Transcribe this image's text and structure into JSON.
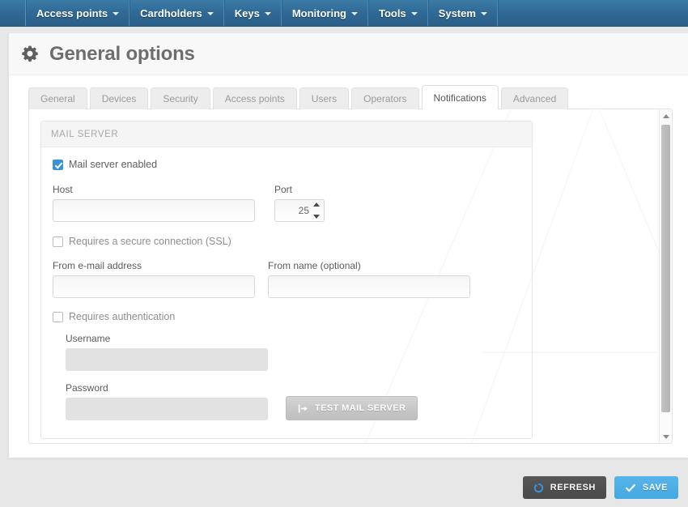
{
  "navbar": {
    "items": [
      {
        "label": "Access points",
        "icon": "chevron-down-icon",
        "has_caret": true
      },
      {
        "label": "Cardholders",
        "icon": "chevron-down-icon",
        "has_caret": true
      },
      {
        "label": "Keys",
        "icon": "chevron-down-icon",
        "has_caret": true
      },
      {
        "label": "Monitoring",
        "icon": "chevron-down-icon",
        "has_caret": true
      },
      {
        "label": "Tools",
        "icon": "chevron-down-icon",
        "has_caret": true
      },
      {
        "label": "System",
        "icon": "chevron-down-icon",
        "has_caret": true
      }
    ]
  },
  "page": {
    "title": "General options",
    "icon": "gear-icon"
  },
  "tabs": [
    {
      "label": "General",
      "active": false
    },
    {
      "label": "Devices",
      "active": false
    },
    {
      "label": "Security",
      "active": false
    },
    {
      "label": "Access points",
      "active": false
    },
    {
      "label": "Users",
      "active": false
    },
    {
      "label": "Operators",
      "active": false
    },
    {
      "label": "Notifications",
      "active": true
    },
    {
      "label": "Advanced",
      "active": false
    }
  ],
  "panel": {
    "title": "MAIL SERVER",
    "mail_server_enabled": {
      "label": "Mail server enabled",
      "checked": true
    },
    "host": {
      "label": "Host",
      "value": "",
      "placeholder": ""
    },
    "port": {
      "label": "Port",
      "value": "25"
    },
    "ssl": {
      "label": "Requires a secure connection (SSL)",
      "checked": false
    },
    "from_email": {
      "label": "From e-mail address",
      "value": "",
      "placeholder": ""
    },
    "from_name": {
      "label": "From name (optional)",
      "value": "",
      "placeholder": ""
    },
    "requires_auth": {
      "label": "Requires authentication",
      "checked": false
    },
    "username": {
      "label": "Username",
      "value": "",
      "disabled": true
    },
    "password": {
      "label": "Password",
      "value": "",
      "disabled": true
    },
    "test_button": {
      "label": "TEST MAIL SERVER",
      "icon": "sign-in-arrow-icon",
      "disabled": true
    }
  },
  "scrollbar": {
    "up_icon": "triangle-up-icon",
    "down_icon": "triangle-down-icon"
  },
  "footer": {
    "refresh": {
      "label": "REFRESH",
      "icon": "refresh-circle-icon"
    },
    "save": {
      "label": "SAVE",
      "icon": "check-icon"
    }
  },
  "colors": {
    "nav_blue": "#2e6894",
    "accent_blue": "#3a93d8",
    "save_blue": "#46a9e2",
    "refresh_dark": "#4a4a4a",
    "title_gray": "#6e6e6e"
  }
}
